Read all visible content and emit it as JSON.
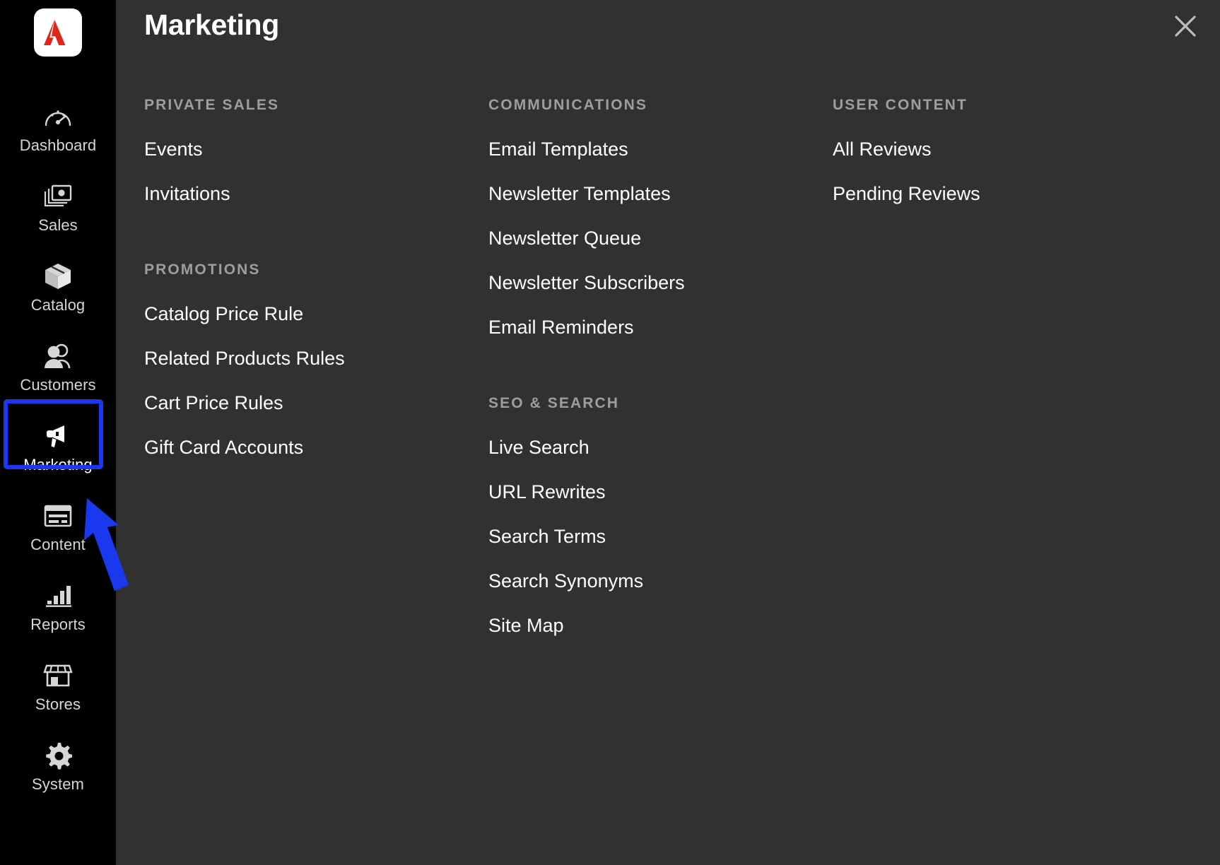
{
  "sidebar": {
    "brand_icon": "adobe-logo-icon",
    "brand_color": "#e1251b",
    "items": [
      {
        "label": "Dashboard",
        "icon": "gauge-icon",
        "active": false
      },
      {
        "label": "Sales",
        "icon": "money-stack-icon",
        "active": false
      },
      {
        "label": "Catalog",
        "icon": "box-icon",
        "active": false
      },
      {
        "label": "Customers",
        "icon": "people-icon",
        "active": false
      },
      {
        "label": "Marketing",
        "icon": "megaphone-icon",
        "active": true
      },
      {
        "label": "Content",
        "icon": "layout-card-icon",
        "active": false
      },
      {
        "label": "Reports",
        "icon": "bar-chart-icon",
        "active": false
      },
      {
        "label": "Stores",
        "icon": "storefront-icon",
        "active": false
      },
      {
        "label": "System",
        "icon": "gear-icon",
        "active": false
      }
    ]
  },
  "panel": {
    "title": "Marketing",
    "close_icon": "close-icon",
    "columns": [
      {
        "groups": [
          {
            "title": "Private Sales",
            "items": [
              "Events",
              "Invitations"
            ]
          },
          {
            "title": "Promotions",
            "items": [
              "Catalog Price Rule",
              "Related Products Rules",
              "Cart Price Rules",
              "Gift Card Accounts"
            ]
          }
        ]
      },
      {
        "groups": [
          {
            "title": "Communications",
            "items": [
              "Email Templates",
              "Newsletter Templates",
              "Newsletter Queue",
              "Newsletter Subscribers",
              "Email Reminders"
            ]
          },
          {
            "title": "SEO & Search",
            "items": [
              "Live Search",
              "URL Rewrites",
              "Search Terms",
              "Search Synonyms",
              "Site Map"
            ]
          }
        ]
      },
      {
        "groups": [
          {
            "title": "User Content",
            "items": [
              "All Reviews",
              "Pending Reviews"
            ]
          }
        ]
      }
    ]
  },
  "annotations": {
    "highlight_color": "#1a39ee",
    "highlight_target": "Marketing",
    "arrow_color": "#1a39ee"
  }
}
